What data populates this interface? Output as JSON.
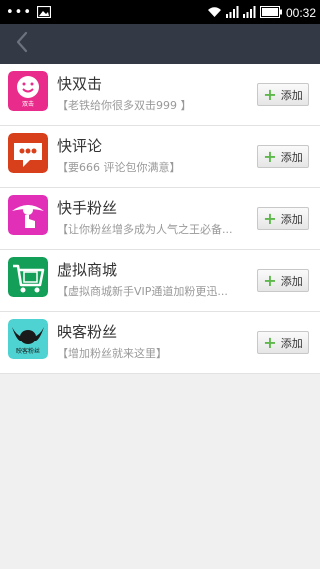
{
  "status_bar": {
    "dots": "•••",
    "time": "00:32",
    "icons": [
      "image-icon",
      "wifi-icon",
      "signal-icon",
      "signal-icon",
      "battery-icon"
    ]
  },
  "header": {
    "back_icon": "chevron-left-icon",
    "background_color": "#333a45"
  },
  "items": [
    {
      "title": "快双击",
      "description": "【老铁给你很多双击999 】",
      "icon_color": "#e92c8b",
      "add_label": "添加",
      "icon_caption": "双击"
    },
    {
      "title": "快评论",
      "description": "【要666 评论包你满意】",
      "icon_color": "#d8401b",
      "add_label": "添加"
    },
    {
      "title": "快手粉丝",
      "description": "【让你粉丝增多成为人气之王必备...",
      "icon_color": "#e12fb8",
      "add_label": "添加"
    },
    {
      "title": "虚拟商城",
      "description": "【虚拟商城新手VIP通道加粉更迅...",
      "icon_color": "#149f58",
      "add_label": "添加"
    },
    {
      "title": "映客粉丝",
      "description": "【增加粉丝就来这里】",
      "icon_color": "#4fd3d2",
      "add_label": "添加",
      "icon_caption": "映客粉丝"
    }
  ]
}
